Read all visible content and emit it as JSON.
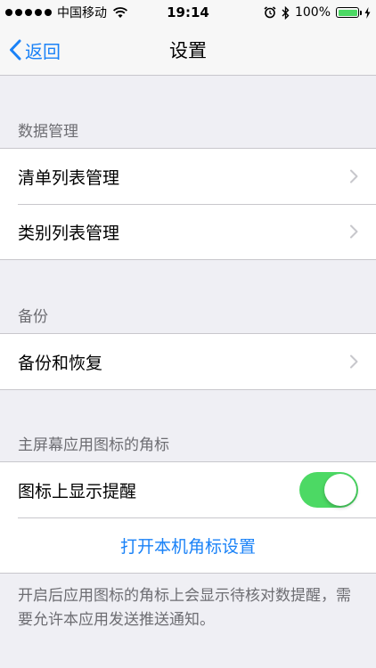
{
  "status_bar": {
    "carrier": "中国移动",
    "time": "19:14",
    "battery_text": "100%",
    "battery_level": 1.0,
    "icons": [
      "signal-dots",
      "wifi-icon",
      "alarm-icon",
      "bluetooth-icon",
      "battery-icon",
      "charging-icon"
    ]
  },
  "nav": {
    "back_label": "返回",
    "title": "设置"
  },
  "sections": {
    "data_management": {
      "header": "数据管理",
      "items": [
        "清单列表管理",
        "类别列表管理"
      ]
    },
    "backup": {
      "header": "备份",
      "items": [
        "备份和恢复"
      ]
    },
    "badge": {
      "header": "主屏幕应用图标的角标",
      "toggle_label": "图标上显示提醒",
      "toggle_on": true,
      "link_label": "打开本机角标设置",
      "footer": "开启后应用图标的角标上会显示待核对数提醒，需要允许本应用发送推送通知。"
    }
  },
  "colors": {
    "accent": "#1a82f7",
    "toggle_on": "#4cd964",
    "background": "#efeff4"
  }
}
